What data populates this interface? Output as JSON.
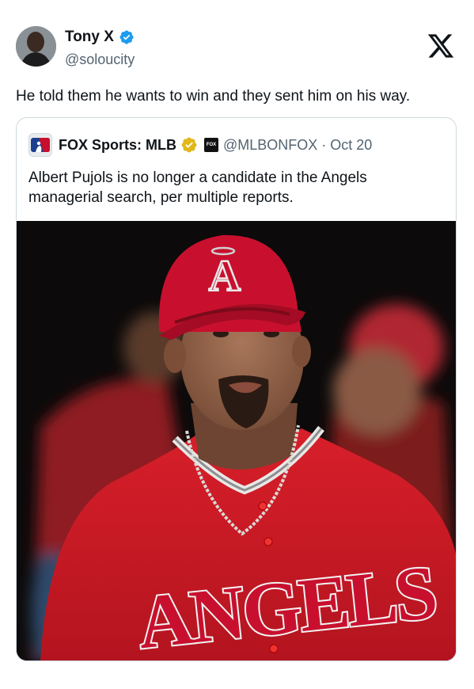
{
  "tweet": {
    "author_name": "Tony X",
    "author_handle": "@soloucity",
    "text": "He told them he wants to win and they sent him on his way."
  },
  "quote": {
    "author_name": "FOX Sports: MLB",
    "author_handle": "@MLBONFOX",
    "separator": "·",
    "date": "Oct 20",
    "text": "Albert Pujols is no longer a candidate in the Angels managerial search, per multiple reports.",
    "affiliate_badge": "FOX",
    "media": {
      "cap_logo": "A",
      "jersey_text": "ANGELS"
    }
  },
  "colors": {
    "verified_blue": "#1d9bf0",
    "verified_gold": "#e2b719",
    "handle_gray": "#536471",
    "angels_red": "#c8102e"
  },
  "icons": {
    "verified": "verified-badge-icon",
    "x_logo": "x-logo-icon",
    "gold_verified": "gold-verified-badge-icon"
  }
}
